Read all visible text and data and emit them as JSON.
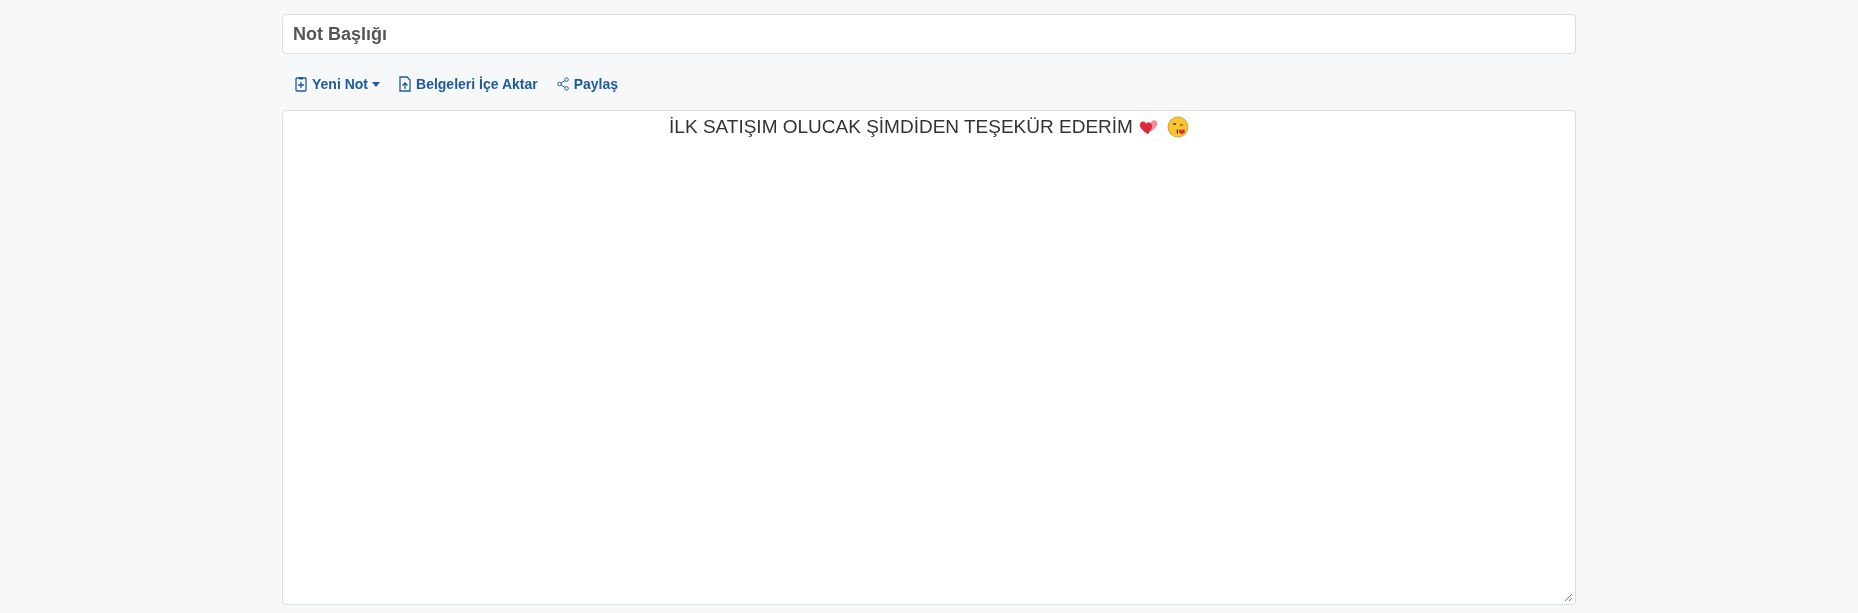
{
  "title_field": {
    "value": "Not Başlığı"
  },
  "toolbar": [
    {
      "label": "Yeni Not",
      "kind": "dropdown"
    },
    {
      "label": "Belgeleri İçe Aktar",
      "kind": "import"
    },
    {
      "label": "Paylaş",
      "kind": "share"
    }
  ],
  "editor": {
    "text": "İLK SATIŞIM OLUCAK ŞİMDİDEN TEŞEKÜR EDERİM"
  }
}
